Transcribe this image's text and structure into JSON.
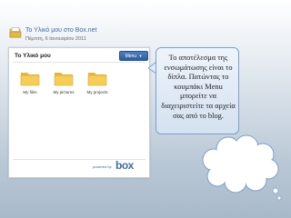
{
  "post": {
    "title": "Το Υλικό μου στο Box.net",
    "date": "Πέμπτη, 6 Ιανουαρίου 2011",
    "icon": "blog-post-icon"
  },
  "widget": {
    "title": "Το Υλικό μου",
    "menu_label": "Menu",
    "menu_arrow": "▼",
    "folders": [
      {
        "name": "My files"
      },
      {
        "name": "My pictures"
      },
      {
        "name": "My projects"
      }
    ],
    "powered_by": "powered by",
    "logo": "box",
    "colors": {
      "accent": "#3a6ea5",
      "menu": "#2d5ea3",
      "folder": "#f3c64b"
    }
  },
  "callout": {
    "text": "Το αποτέλεσμα της ενσωμάτωσης είναι το δίπλα. Πατώντας το κουμπάκι Menu μπορείτε να διαχειριστείτε τα αρχεία σας από το blog."
  }
}
